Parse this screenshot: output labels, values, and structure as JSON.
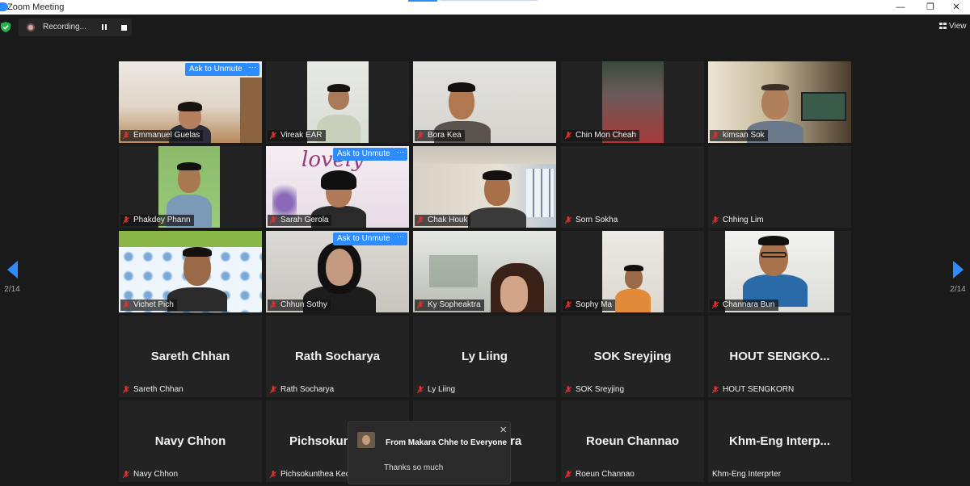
{
  "window": {
    "title": "Zoom Meeting",
    "minimize": "—",
    "restore": "❐",
    "close": "✕"
  },
  "toolbar": {
    "recording_label": "Recording...",
    "view_label": "View"
  },
  "paging": {
    "left_page": "2/14",
    "right_page": "2/14"
  },
  "tiles": [
    {
      "name": "Emmanuel Guelas",
      "ask_unmute": "Ask to Unmute",
      "more": "···"
    },
    {
      "name": "Vireak EAR"
    },
    {
      "name": "Bora Kea"
    },
    {
      "name": "Chin Mon Cheah"
    },
    {
      "name": "kimsan Sok"
    },
    {
      "name": "Phakdey Phann"
    },
    {
      "name": "Sarah Gerola",
      "ask_unmute": "Ask to Unmute",
      "more": "···",
      "bg_text": "lovely"
    },
    {
      "name": "Chak Houk"
    },
    {
      "name": "Sorn Sokha"
    },
    {
      "name": "Chhing Lim"
    },
    {
      "name": "Vichet Pich"
    },
    {
      "name": "Chhun Sothy",
      "ask_unmute": "Ask to Unmute",
      "more": "···"
    },
    {
      "name": "Ky Sopheaktra"
    },
    {
      "name": "Sophy Ma"
    },
    {
      "name": "Channara Bun"
    },
    {
      "name": "Sareth Chhan",
      "display": "Sareth Chhan"
    },
    {
      "name": "Rath Socharya",
      "display": "Rath Socharya"
    },
    {
      "name": "Ly Liing",
      "display": "Ly Liing"
    },
    {
      "name": "SOK Sreyjing",
      "display": "SOK Sreyjing"
    },
    {
      "name": "HOUT SENGKORN",
      "display": "HOUT  SENGKO..."
    },
    {
      "name": "Navy Chhon",
      "display": "Navy Chhon"
    },
    {
      "name": "Pichsokunthea Kec",
      "display": "Pichsokun"
    },
    {
      "name": "",
      "display": "ra"
    },
    {
      "name": "Roeun Channao",
      "display": "Roeun Channao"
    },
    {
      "name": "Khm-Eng Interprter",
      "display": "Khm-Eng  Interp..."
    }
  ],
  "chat": {
    "from": "From Makara Chhe to Everyone",
    "message": "Thanks so much",
    "close": "✕"
  },
  "colors": {
    "accent": "#2d8cff",
    "muted_mic": "#e0312e",
    "shield": "#27b34b"
  }
}
